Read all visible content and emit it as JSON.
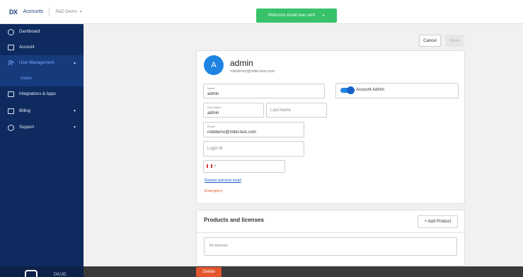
{
  "topbar": {
    "logo": "DX",
    "app_name": "Accounts",
    "account": "R&D Demo"
  },
  "toast": {
    "message": "Welcome email was sent",
    "close": "×"
  },
  "sidebar": {
    "items": [
      {
        "label": "Dashboard",
        "icon": "dashboard-icon"
      },
      {
        "label": "Account",
        "icon": "account-icon"
      },
      {
        "label": "User Management",
        "icon": "users-icon",
        "expanded": true
      },
      {
        "label": "Users",
        "icon": ""
      },
      {
        "label": "Integrations & Apps",
        "icon": "integrations-icon"
      },
      {
        "label": "Billing",
        "icon": "billing-icon",
        "expandable": true
      },
      {
        "label": "Support",
        "icon": "support-icon",
        "expandable": true
      }
    ],
    "user_short": "DK/JG"
  },
  "actions": {
    "cancel": "Cancel",
    "save": "Save",
    "delete": "Delete"
  },
  "user": {
    "initial": "A",
    "name": "admin",
    "email": "rotddemo@mitel-test.com"
  },
  "form": {
    "name_label": "Name",
    "name_value": "admin",
    "first_name_label": "First Name",
    "first_name_value": "admin",
    "last_name_placeholder": "Last Name",
    "email_label": "Email *",
    "email_value": "rotddemo@mitel-test.com",
    "login_id_placeholder": "Login Id",
    "phone_country": "CA",
    "account_admin_label": "Account Admin",
    "account_admin_on": true,
    "resend_link": "Resend welcome email",
    "status": "Emergency"
  },
  "products": {
    "title": "Products and licenses",
    "add_button": "+ Add Product",
    "empty_text": "No licenses"
  },
  "colors": {
    "sidebar_bg": "#0e2a5e",
    "accent": "#1f84e0",
    "toast_bg": "#37c26a",
    "danger": "#e4572e"
  }
}
